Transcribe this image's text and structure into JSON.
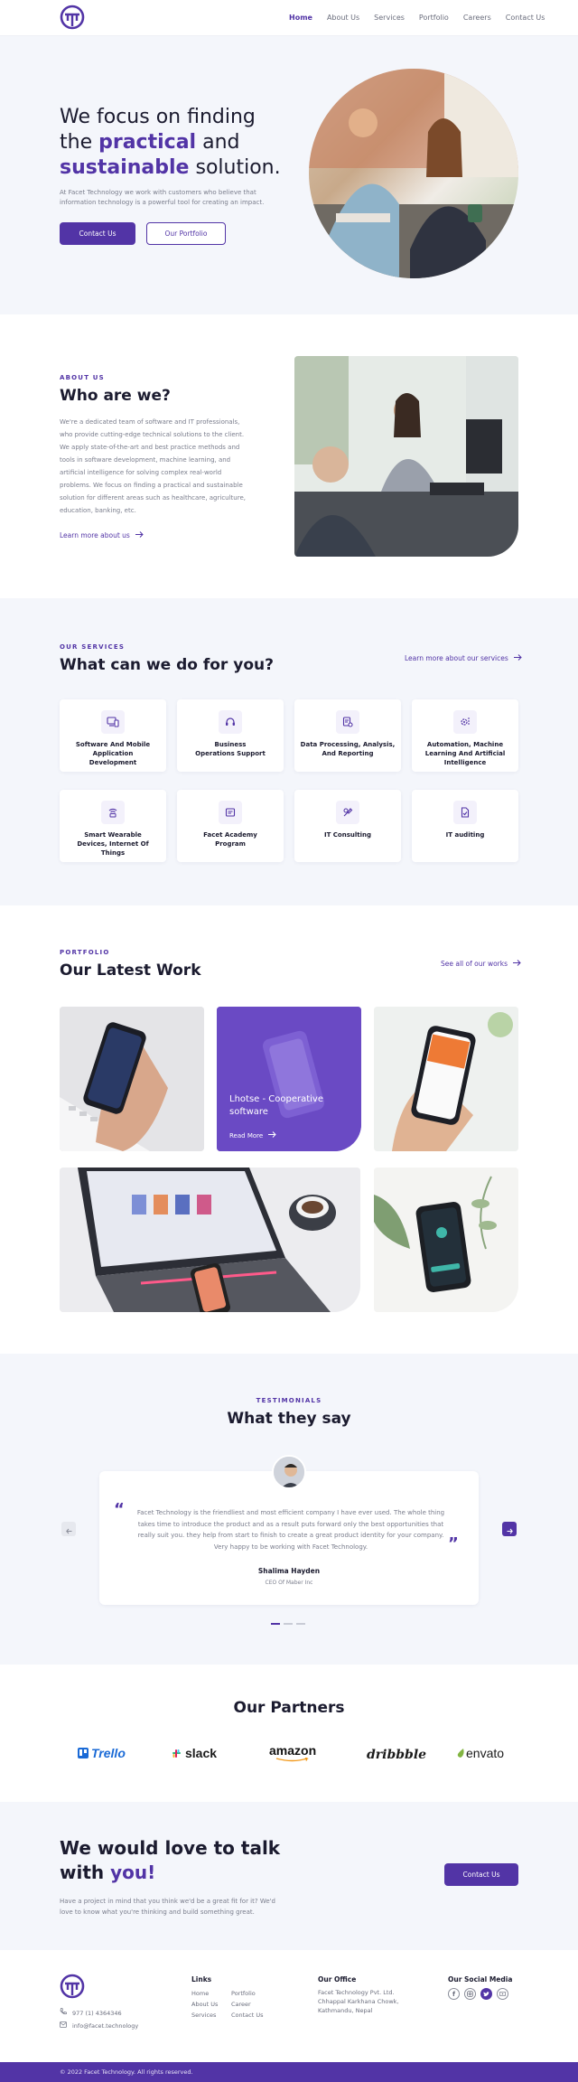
{
  "nav": {
    "items": [
      "Home",
      "About Us",
      "Services",
      "Portfolio",
      "Careers",
      "Contact Us"
    ]
  },
  "hero": {
    "line1": "We focus on finding",
    "line2_pre": "the ",
    "line2_em": "practical",
    "line2_post": " and",
    "line3_em": "sustainable",
    "line3_post": " solution.",
    "body": "At Facet Technology we work with customers who believe that information technology is a powerful tool for creating an impact.",
    "primary_btn": "Contact Us",
    "secondary_btn": "Our Portfolio"
  },
  "about": {
    "eyebrow": "ABOUT US",
    "title": "Who are we?",
    "body": "We're a dedicated team of software and IT professionals, who provide cutting-edge technical solutions to the client. We apply state-of-the-art and best practice methods and tools in software development, machine learning, and artificial intelligence for solving complex real-world problems. We focus on finding a practical and sustainable solution for different areas such as healthcare, agriculture, education, banking, etc.",
    "link": "Learn more about us"
  },
  "services": {
    "eyebrow": "OUR SERVICES",
    "title": "What can we do for you?",
    "link": "Learn more about our services",
    "items": [
      {
        "label": "Software And Mobile Application Development",
        "icon": "devices-icon"
      },
      {
        "label": "Business Operations Support",
        "icon": "headset-icon"
      },
      {
        "label": "Data Processing, Analysis, And Reporting",
        "icon": "data-report-icon"
      },
      {
        "label": "Automation, Machine Learning And Artificial Intelligence",
        "icon": "gear-ai-icon"
      },
      {
        "label": "Smart Wearable Devices, Internet Of Things",
        "icon": "iot-icon"
      },
      {
        "label": "Facet Academy Program",
        "icon": "academy-icon"
      },
      {
        "label": "IT Consulting",
        "icon": "consulting-icon"
      },
      {
        "label": "IT auditing",
        "icon": "audit-icon"
      }
    ]
  },
  "portfolio": {
    "eyebrow": "PORTFOLIO",
    "title": "Our Latest Work",
    "link": "See all of our works",
    "featured_title": "Lhotse - Cooperative software",
    "featured_link": "Read More"
  },
  "testimonials": {
    "eyebrow": "TESTIMONIALS",
    "title": "What they say",
    "quote": "Facet Technology is the friendliest and most efficient company I have ever used. The whole thing takes time to introduce the product and as a result puts forward only the best opportunities that really suit you. they help from start to finish to create a great product identity for your company. Very happy to be working with Facet Technology.",
    "name": "Shalima Hayden",
    "role": "CEO Of Maber Inc"
  },
  "partners": {
    "title": "Our Partners",
    "logos": [
      "Trello",
      "slack",
      "amazon",
      "dribbble",
      "envato"
    ]
  },
  "cta": {
    "line1": "We would love to talk",
    "line2_pre": "with ",
    "line2_em": "you!",
    "body": "Have a project in mind that you think we'd be a great fit for it? We'd love to know what you're thinking and build something great.",
    "button": "Contact Us"
  },
  "footer": {
    "phone": "977 (1) 4364346",
    "email": "info@facet.technology",
    "links_title": "Links",
    "links_col1": [
      "Home",
      "About Us",
      "Services"
    ],
    "links_col2": [
      "Portfolio",
      "Career",
      "Contact Us"
    ],
    "office_title": "Our Office",
    "office_lines": [
      "Facet Technology Pvt. Ltd.",
      "Chhappal Karkhana Chowk,",
      "Kathmandu, Nepal"
    ],
    "social_title": "Our Social Media",
    "social_icons": [
      "facebook-icon",
      "instagram-icon",
      "twitter-icon",
      "youtube-icon"
    ],
    "copyright": "© 2022 Facet Technology. All rights reserved."
  },
  "colors": {
    "accent": "#5234a6",
    "section_bg": "#f4f6fb",
    "text": "#1b1b2f"
  }
}
